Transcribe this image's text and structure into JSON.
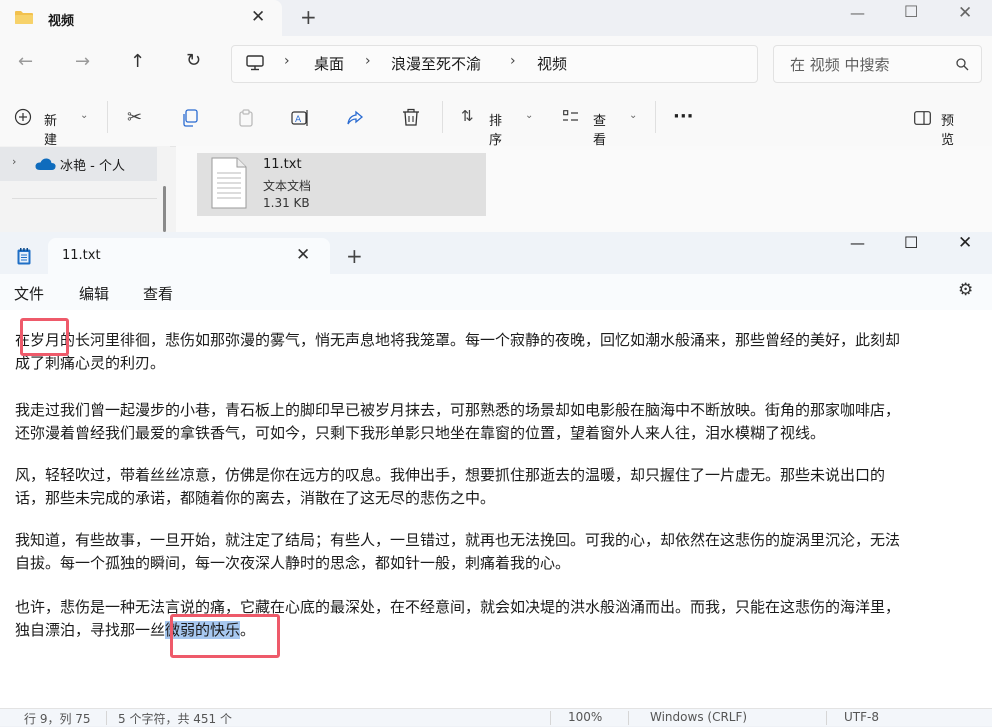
{
  "explorer": {
    "tab_title": "视频",
    "search_placeholder": "在 视频 中搜索",
    "breadcrumb": [
      "桌面",
      "浪漫至死不渝",
      "视频"
    ],
    "toolbar": {
      "new_label": "新建",
      "sort_label": "排序",
      "view_label": "查看",
      "more_label": "···",
      "preview_label": "预览"
    },
    "nav_item": "冰艳 - 个人",
    "file": {
      "name": "11.txt",
      "type": "文本文档",
      "size": "1.31 KB"
    }
  },
  "notepad": {
    "tab_title": "11.txt",
    "menu": [
      "文件",
      "编辑",
      "查看"
    ],
    "paragraphs": [
      {
        "lines": [
          "在岁月的长河里徘徊，悲伤如那弥漫的雾气，悄无声息地将我笼罩。每一个寂静的夜晚，回忆如潮水般涌来，那些曾经的美好，此刻却",
          "成了刺痛心灵的利刃。"
        ]
      },
      {
        "lines": [
          "我走过我们曾一起漫步的小巷，青石板上的脚印早已被岁月抹去，可那熟悉的场景却如电影般在脑海中不断放映。街角的那家咖啡店，",
          "还弥漫着曾经我们最爱的拿铁香气，可如今，只剩下我形单影只地坐在靠窗的位置，望着窗外人来人往，泪水模糊了视线。"
        ]
      },
      {
        "lines": [
          "风，轻轻吹过，带着丝丝凉意，仿佛是你在远方的叹息。我伸出手，想要抓住那逝去的温暖，却只握住了一片虚无。那些未说出口的",
          "话，那些未完成的承诺，都随着你的离去，消散在了这无尽的悲伤之中。"
        ]
      },
      {
        "lines": [
          "我知道，有些故事，一旦开始，就注定了结局；有些人，一旦错过，就再也无法挽回。可我的心，却依然在这悲伤的旋涡里沉沦，无法",
          "自拔。每一个孤独的瞬间，每一次夜深人静时的思念，都如针一般，刺痛着我的心。"
        ]
      },
      {
        "lines": [
          "也许，悲伤是一种无法言说的痛，它藏在心底的最深处，在不经意间，就会如决堤的洪水般汹涌而出。而我，只能在这悲伤的海洋里，",
          "独自漂泊，寻找那一丝"
        ]
      }
    ],
    "selected_text": "微弱的快乐",
    "after_selection": "。",
    "status": {
      "position": "行 9，列 75",
      "selection": "5 个字符，共 451 个",
      "zoom": "100%",
      "line_ending": "Windows (CRLF)",
      "encoding": "UTF-8"
    }
  },
  "colors": {
    "annotation_red": "#ee5a6a",
    "selection_blue": "#a7c8f0",
    "onedrive_blue": "#0f6cbd"
  }
}
